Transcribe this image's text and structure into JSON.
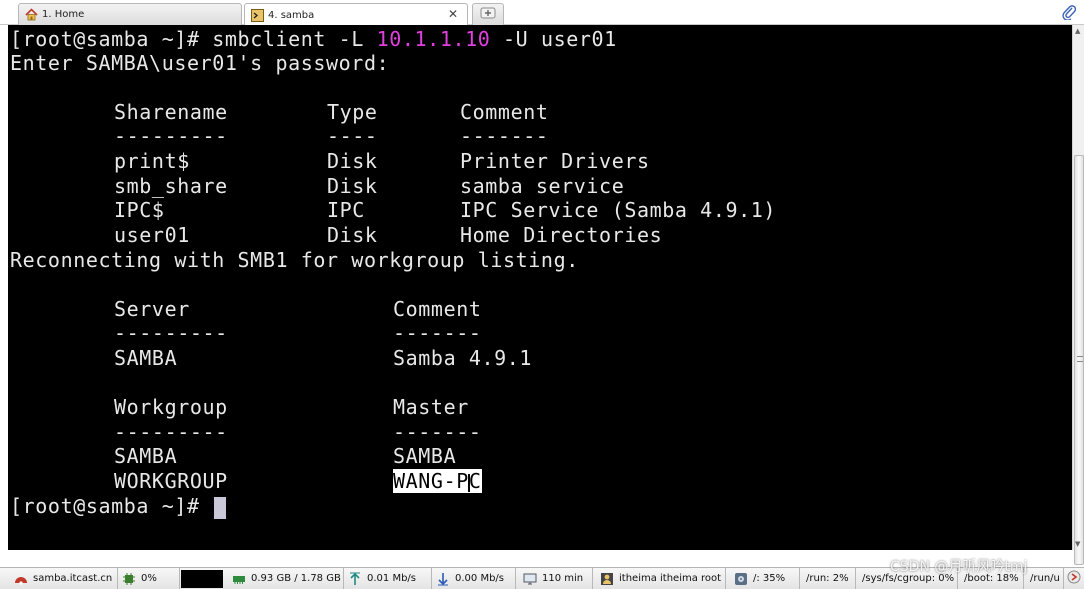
{
  "tabs": [
    {
      "label": "1. Home",
      "active": false
    },
    {
      "label": "4. samba",
      "active": true
    }
  ],
  "terminal": {
    "line1": {
      "prompt": "[root@samba ~]# ",
      "cmd_a": "smbclient -L ",
      "host": "10.1.1.10",
      "cmd_b": " -U user01"
    },
    "line2": "Enter SAMBA\\user01's password:",
    "shares_header": {
      "name": "Sharename",
      "type": "Type",
      "comment": "Comment"
    },
    "shares_sep": {
      "name": "---------",
      "type": "----",
      "comment": "-------"
    },
    "shares": [
      {
        "name": "print$",
        "type": "Disk",
        "comment": "Printer Drivers"
      },
      {
        "name": "smb_share",
        "type": "Disk",
        "comment": "samba service"
      },
      {
        "name": "IPC$",
        "type": "IPC",
        "comment": "IPC Service (Samba 4.9.1)"
      },
      {
        "name": "user01",
        "type": "Disk",
        "comment": "Home Directories"
      }
    ],
    "reconnect": "Reconnecting with SMB1 for workgroup listing.",
    "server_header": {
      "name": "Server",
      "comment": "Comment"
    },
    "server_sep": {
      "name": "---------",
      "comment": "-------"
    },
    "server_row": {
      "name": "SAMBA",
      "comment": "Samba 4.9.1"
    },
    "wg_header": {
      "name": "Workgroup",
      "master": "Master"
    },
    "wg_sep": {
      "name": "---------",
      "master": "-------"
    },
    "wg_rows": [
      {
        "name": "SAMBA",
        "master": "SAMBA"
      },
      {
        "name": "WORKGROUP",
        "master_a": "WANG-P",
        "master_b": "C"
      }
    ],
    "final_prompt": "[root@samba ~]# "
  },
  "statusbar": {
    "host": "samba.itcast.cn",
    "cpu": "0%",
    "mem": "0.93 GB / 1.78 GB",
    "upload": "0.01 Mb/s",
    "download": "0.00 Mb/s",
    "uptime": "110 min",
    "users": "itheima  itheima  root",
    "disk_root": "/: 35%",
    "disk_run": "/run: 2%",
    "disk_cgroup": "/sys/fs/cgroup: 0%",
    "disk_boot": "/boot: 18%",
    "disk_runu": "/run/u"
  },
  "watermark": "CSDN @月听风吟tmj",
  "colors": {
    "terminal_bg": "#000000",
    "terminal_fg": "#e8e8e8",
    "host_highlight": "#e040e0"
  }
}
